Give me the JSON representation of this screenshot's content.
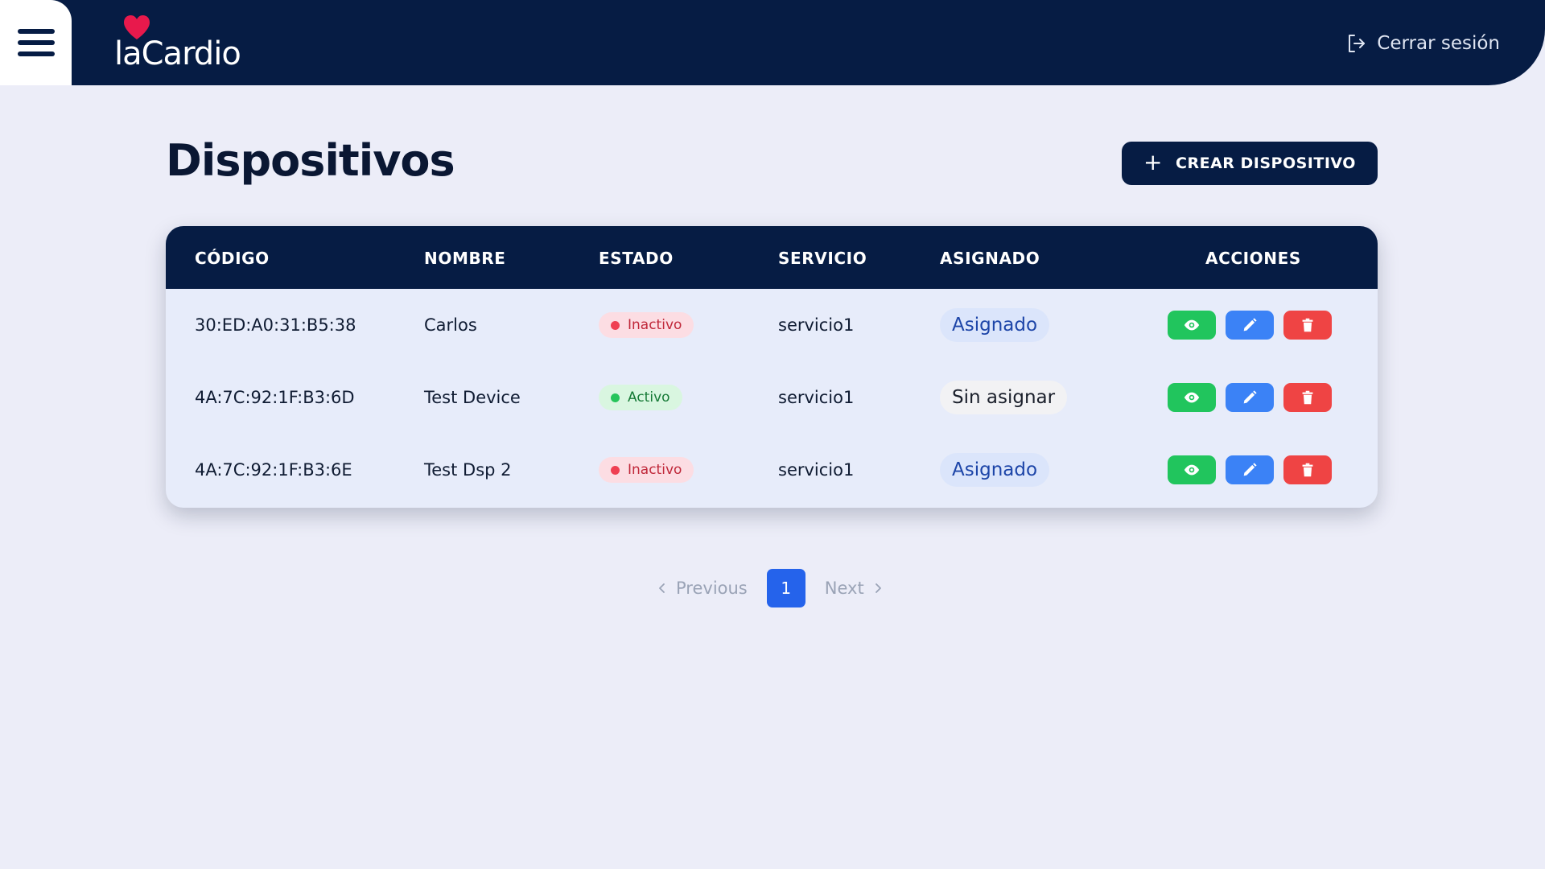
{
  "app": {
    "logo_text": "laCardio",
    "logout_label": "Cerrar sesión"
  },
  "page": {
    "title": "Dispositivos",
    "create_button": "CREAR DISPOSITIVO"
  },
  "table": {
    "headers": [
      "CÓDIGO",
      "NOMBRE",
      "ESTADO",
      "SERVICIO",
      "ASIGNADO",
      "ACCIONES"
    ],
    "rows": [
      {
        "code": "30:ED:A0:31:B5:38",
        "name": "Carlos",
        "status": "Inactivo",
        "service": "servicio1",
        "assigned": "Asignado"
      },
      {
        "code": "4A:7C:92:1F:B3:6D",
        "name": "Test Device",
        "status": "Activo",
        "service": "servicio1",
        "assigned": "Sin asignar"
      },
      {
        "code": "4A:7C:92:1F:B3:6E",
        "name": "Test Dsp 2",
        "status": "Inactivo",
        "service": "servicio1",
        "assigned": "Asignado"
      }
    ]
  },
  "pagination": {
    "previous": "Previous",
    "current": "1",
    "next": "Next"
  },
  "colors": {
    "nav_bg": "#061c44",
    "page_bg": "#ecedf8",
    "view_btn": "#21c55d",
    "edit_btn": "#3b82f6",
    "delete_btn": "#ef4444",
    "active_page": "#2563eb",
    "logo_heart": "#e8194c"
  },
  "icons": {
    "menu": "hamburger-menu-icon",
    "logo": "heart-icon",
    "logout": "logout-icon",
    "create": "plus-icon",
    "view": "eye-icon",
    "edit": "pencil-icon",
    "delete": "trash-icon",
    "prev": "chevron-left-icon",
    "next": "chevron-right-icon"
  }
}
